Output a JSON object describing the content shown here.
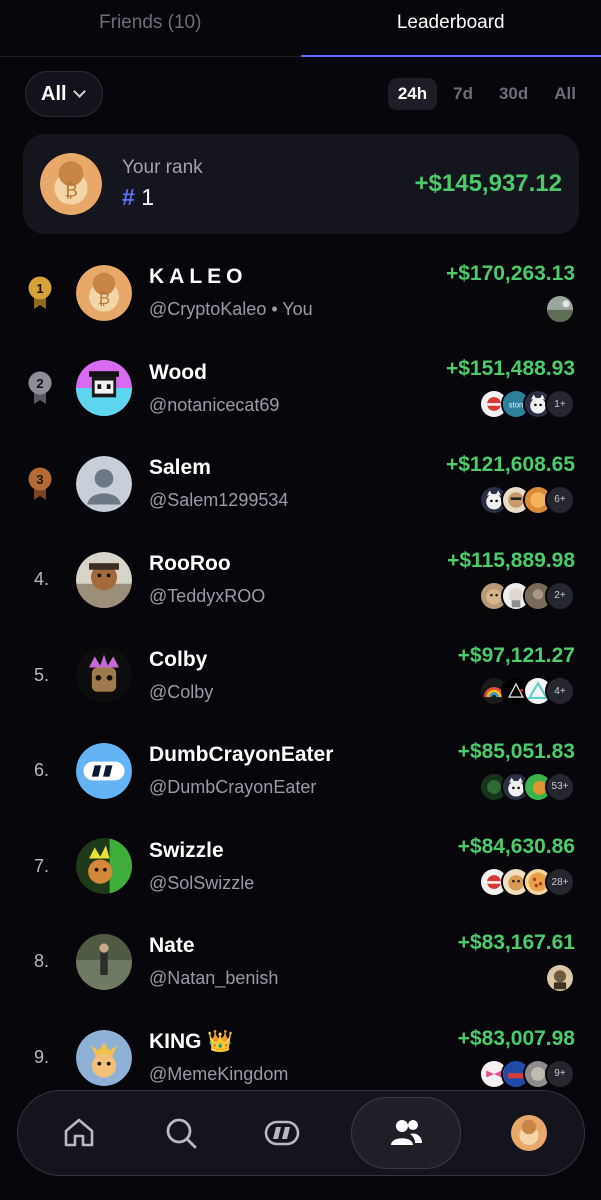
{
  "tabs": [
    {
      "label": "Friends (10)",
      "active": false
    },
    {
      "label": "Leaderboard",
      "active": true
    }
  ],
  "filter": {
    "selected": "All",
    "periods": [
      {
        "label": "24h",
        "active": true
      },
      {
        "label": "7d",
        "active": false
      },
      {
        "label": "30d",
        "active": false
      },
      {
        "label": "All",
        "active": false
      }
    ]
  },
  "your_rank": {
    "label": "Your rank",
    "hash": "#",
    "rank": "1",
    "pnl": "+$145,937.12"
  },
  "leaderboard": [
    {
      "rank": "1",
      "medal": "gold",
      "name": "KALEO",
      "handle": "@CryptoKaleo • You",
      "pnl": "+$170,263.13",
      "avatar": "doge-bitcoin",
      "followers": [
        "landscape"
      ],
      "more": ""
    },
    {
      "rank": "2",
      "medal": "silver",
      "name": "Wood",
      "handle": "@notanicecat69",
      "pnl": "+$151,488.93",
      "avatar": "pixel-character",
      "followers": [
        "red-white",
        "ston-logo",
        "cat"
      ],
      "more": "1+"
    },
    {
      "rank": "3",
      "medal": "bronze",
      "name": "Salem",
      "handle": "@Salem1299534",
      "pnl": "+$121,608.65",
      "avatar": "default-user",
      "followers": [
        "cat",
        "beige-face",
        "orange-face"
      ],
      "more": "6+"
    },
    {
      "rank": "4.",
      "medal": "",
      "name": "RooRoo",
      "handle": "@TeddyxROO",
      "pnl": "+$115,889.98",
      "avatar": "teddy-bear",
      "followers": [
        "tan-animal",
        "white-face",
        "brown-photo"
      ],
      "more": "2+"
    },
    {
      "rank": "5.",
      "medal": "",
      "name": "Colby",
      "handle": "@Colby",
      "pnl": "+$97,121.27",
      "avatar": "crowned-creature",
      "followers": [
        "rainbow",
        "prism",
        "triangle"
      ],
      "more": "4+"
    },
    {
      "rank": "6.",
      "medal": "",
      "name": "DumbCrayonEater",
      "handle": "@DumbCrayonEater",
      "pnl": "+$85,051.83",
      "avatar": "blue-logo",
      "followers": [
        "dark-green",
        "cat",
        "green-orange"
      ],
      "more": "53+"
    },
    {
      "rank": "7.",
      "medal": "",
      "name": "Swizzle",
      "handle": "@SolSwizzle",
      "pnl": "+$84,630.86",
      "avatar": "green-crown-creature",
      "followers": [
        "red-white",
        "doge",
        "pizza"
      ],
      "more": "28+"
    },
    {
      "rank": "8.",
      "medal": "",
      "name": "Nate",
      "handle": "@Natan_benish",
      "pnl": "+$83,167.61",
      "avatar": "person-outdoors",
      "followers": [
        "sepia"
      ],
      "more": ""
    },
    {
      "rank": "9.",
      "medal": "",
      "name": "KING 👑",
      "handle": "@MemeKingdom",
      "pnl": "+$83,007.98",
      "avatar": "king-cat",
      "followers": [
        "pink-bow",
        "blue-red",
        "grey-photo"
      ],
      "more": "9+"
    }
  ],
  "bottom_nav": [
    {
      "icon": "home-icon",
      "active": false
    },
    {
      "icon": "search-icon",
      "active": false
    },
    {
      "icon": "app-logo-icon",
      "active": false
    },
    {
      "icon": "friends-icon",
      "active": true
    },
    {
      "icon": "profile-avatar",
      "active": false
    }
  ],
  "colors": {
    "background": "#06060b",
    "positive": "#4ccb6a",
    "accent": "#5a6cf0",
    "gold": "#d6a23a",
    "silver": "#8e8e98",
    "bronze": "#b36a35"
  }
}
